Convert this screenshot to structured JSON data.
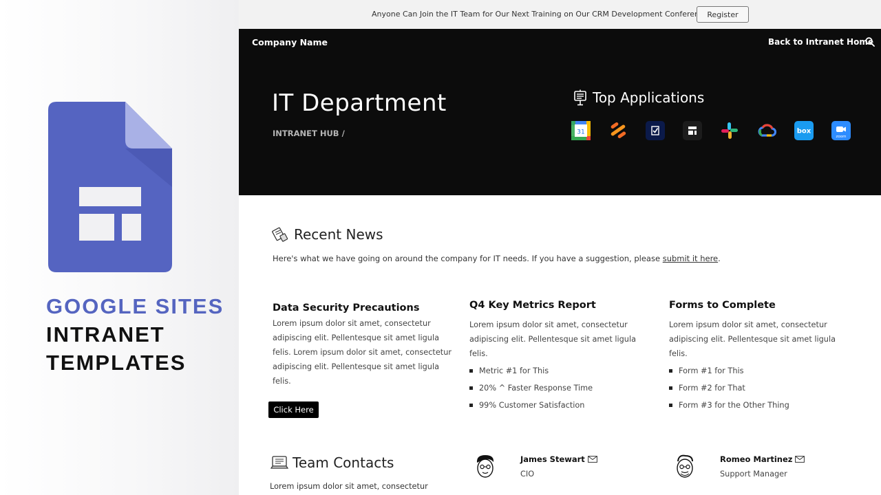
{
  "promo": {
    "line1": "GOOGLE SITES",
    "line2": "INTRANET",
    "line3": "TEMPLATES",
    "accent": "#5565c0"
  },
  "announcement": {
    "text": "Anyone Can Join the IT Team for Our Next Training on Our CRM Development Conference",
    "register_label": "Register"
  },
  "nav": {
    "company": "Company Name",
    "back_link": "Back to Intranet Home"
  },
  "hero": {
    "title": "IT Department",
    "breadcrumb": "INTRANET HUB /",
    "apps_heading": "Top Applications",
    "apps": [
      {
        "icon": "google-calendar-icon",
        "text": "31"
      },
      {
        "icon": "asana-like-icon"
      },
      {
        "icon": "checkmark-app-icon"
      },
      {
        "icon": "notion-like-icon"
      },
      {
        "icon": "slack-icon"
      },
      {
        "icon": "google-cloud-icon"
      },
      {
        "icon": "box-icon",
        "text": "box"
      },
      {
        "icon": "zoom-icon",
        "text": "zoom"
      }
    ]
  },
  "news": {
    "title": "Recent News",
    "desc_prefix": "Here's what we have going on around the company for IT needs. If you have a suggestion, please ",
    "desc_link": "submit it here",
    "desc_suffix": ".",
    "columns": [
      {
        "title": "Data Security Precautions",
        "body": "Lorem ipsum dolor sit amet, consectetur adipiscing elit. Pellentesque sit amet ligula felis. Lorem ipsum dolor sit amet, consectetur adipiscing elit. Pellentesque sit amet ligula felis.",
        "button": "Click Here"
      },
      {
        "title": "Q4 Key Metrics Report",
        "body": "Lorem ipsum dolor sit amet, consectetur adipiscing elit. Pellentesque sit amet ligula felis.",
        "items": [
          "Metric #1 for This",
          "20% ^ Faster Response Time",
          "99% Customer Satisfaction"
        ]
      },
      {
        "title": "Forms to Complete",
        "body": "Lorem ipsum dolor sit amet, consectetur adipiscing elit. Pellentesque sit amet ligula felis.",
        "items": [
          "Form #1 for This",
          "Form #2 for That",
          "Form #3 for the Other Thing"
        ]
      }
    ]
  },
  "team": {
    "title": "Team Contacts",
    "desc": "Lorem ipsum dolor sit amet, consectetur",
    "contacts": [
      {
        "name": "James Stewart",
        "role": "CIO"
      },
      {
        "name": "Romeo Martinez",
        "role": "Support Manager"
      }
    ]
  }
}
